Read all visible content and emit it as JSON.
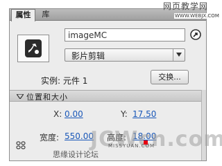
{
  "tabs": [
    {
      "label": "属性"
    },
    {
      "label": "库"
    }
  ],
  "instance": {
    "name_value": "imageMC",
    "type_value": "影片剪辑",
    "instance_label": "实例:",
    "instance_value": "元件 1",
    "swap_label": "交换..."
  },
  "position_section": {
    "title": "位置和大小",
    "x_label": "X:",
    "x_value": "0.00",
    "y_label": "Y:",
    "y_value": "17.50",
    "width_label": "宽度:",
    "width_value": "550.00",
    "height_label": "高度:",
    "height_value": "18.00"
  },
  "watermarks": {
    "site_cn": "网页教学网",
    "site_url": "WWW.WEBJX.COM",
    "brand_big": "JCWcn.com",
    "brand_small": "MISSYUAN.COM",
    "forum": "思缘设计论坛"
  },
  "colors": {
    "accent_link": "#1957b8",
    "panel_bg": "#ececec"
  }
}
